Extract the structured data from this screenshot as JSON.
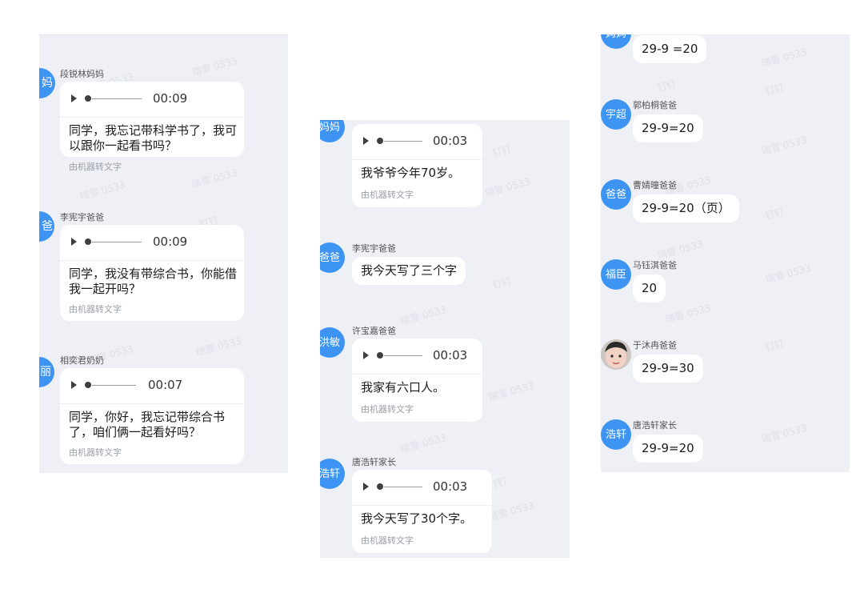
{
  "watermarks": [
    "瑞雪 0533",
    "钉钉"
  ],
  "panels": {
    "left": {
      "messages": [
        {
          "avatar": "妈",
          "name": "段锐林妈妈",
          "duration": "00:09",
          "text": "同学，我忘记带科学书了，我可以跟你一起看书吗？",
          "note": "由机器转文字"
        },
        {
          "avatar": "爸",
          "name": "李宪宇爸爸",
          "duration": "00:09",
          "text": "同学，我没有带综合书，你能借我一起开吗？",
          "note": "由机器转文字"
        },
        {
          "avatar": "丽",
          "name": "相奕君奶奶",
          "duration": "00:07",
          "text": "同学，你好，我忘记带综合书了，咱们俩一起看好吗？",
          "note": "由机器转文字"
        }
      ]
    },
    "middle": {
      "messages": [
        {
          "avatar": "妈妈",
          "duration": "00:03",
          "text": "我爷爷今年70岁。",
          "note": "由机器转文字"
        },
        {
          "avatar": "爸爸",
          "name": "李宪宇爸爸",
          "text": "我今天写了三个字"
        },
        {
          "avatar": "洪敏",
          "name": "许宝嘉爸爸",
          "duration": "00:03",
          "text": "我家有六口人。",
          "note": "由机器转文字"
        },
        {
          "avatar": "浩轩",
          "name": "唐浩轩家长",
          "duration": "00:03",
          "text": "我今天写了30个字。",
          "note": "由机器转文字"
        }
      ]
    },
    "right": {
      "messages": [
        {
          "avatar": "妈妈",
          "text": "29-9 =20"
        },
        {
          "avatar": "宇超",
          "name": "郭柏桐爸爸",
          "text": "29-9=20"
        },
        {
          "avatar": "爸爸",
          "name": "曹婧曈爸爸",
          "text": "29-9=20（页）"
        },
        {
          "avatar": "福臣",
          "name": "马钰淇爸爸",
          "text": "20"
        },
        {
          "avatar": "photo",
          "name": "于沐冉爸爸",
          "text": "29-9=30"
        },
        {
          "avatar": "浩轩",
          "name": "唐浩轩家长",
          "text": "29-9=20"
        }
      ]
    }
  },
  "colors": {
    "avatar": "#3d94f2",
    "panel_bg": "#eef0f5",
    "bubble_bg": "#ffffff",
    "note": "#9aa0a8"
  }
}
